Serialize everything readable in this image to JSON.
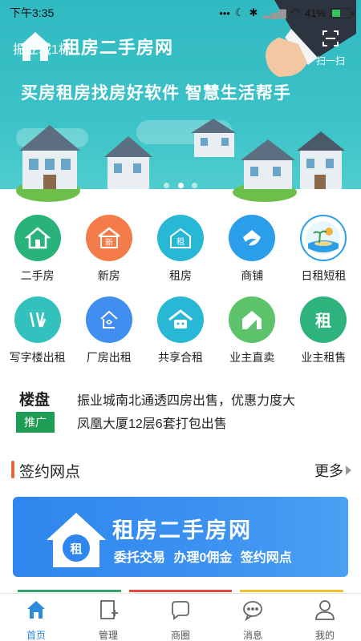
{
  "status_bar": {
    "time": "下午3:35",
    "battery": "41%"
  },
  "banner": {
    "location": "振业城1栋",
    "brand": "租房二手房网",
    "scan_label": "扫一扫",
    "slogan": "买房租房找房好软件 智慧生活帮手",
    "slide_count": 3,
    "active_slide": 1
  },
  "categories": {
    "row1": [
      {
        "label": "二手房",
        "icon": "home-icon",
        "color": "#2ab27b"
      },
      {
        "label": "新房",
        "icon": "new-house-icon",
        "color": "#f47c4a"
      },
      {
        "label": "租房",
        "icon": "rent-house-icon",
        "color": "#28b8d6"
      },
      {
        "label": "商铺",
        "icon": "shop-icon",
        "color": "#2a9ee8"
      },
      {
        "label": "日租短租",
        "icon": "beach-icon",
        "color": "#2a9ee8"
      }
    ],
    "row2": [
      {
        "label": "写字楼出租",
        "icon": "office-icon",
        "color": "#33c1bd"
      },
      {
        "label": "厂房出租",
        "icon": "factory-icon",
        "color": "#3f8ef0"
      },
      {
        "label": "共享合租",
        "icon": "share-house-icon",
        "color": "#28b8d6"
      },
      {
        "label": "业主直卖",
        "icon": "owner-sell-icon",
        "color": "#5dc36a"
      },
      {
        "label": "业主租售",
        "icon": "owner-rent-icon",
        "color": "#2fb37e"
      }
    ]
  },
  "news": {
    "title": "楼盘",
    "badge": "推广",
    "items": [
      "振业城南北通透四房出售，优惠力度大",
      "凤凰大厦12层6套打包出售"
    ]
  },
  "section": {
    "title": "签约网点",
    "more": "更多"
  },
  "agent_card": {
    "logo_text": "租",
    "title": "租房二手房网",
    "subtitle": "委托交易  办理0佣金  签约网点"
  },
  "strips": [
    "#2fa36b",
    "#e24b3b",
    "#f2c230"
  ],
  "tabbar": {
    "items": [
      {
        "label": "首页",
        "icon": "home-tab-icon",
        "active": true
      },
      {
        "label": "管理",
        "icon": "manage-icon",
        "active": false
      },
      {
        "label": "商圈",
        "icon": "chat-circle-icon",
        "active": false
      },
      {
        "label": "消息",
        "icon": "message-icon",
        "active": false
      },
      {
        "label": "我的",
        "icon": "user-icon",
        "active": false
      }
    ]
  },
  "colors": {
    "accent": "#2a8bdc",
    "banner": "#3cc3c8"
  }
}
